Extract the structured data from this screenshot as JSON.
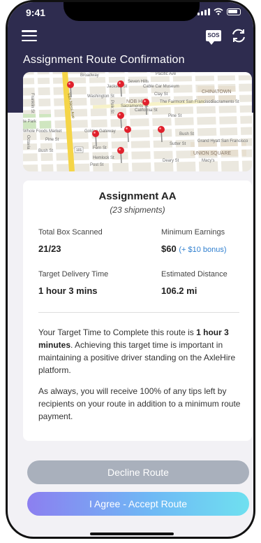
{
  "status_bar": {
    "time": "9:41"
  },
  "header": {
    "title": "Assignment Route Confirmation",
    "sos_label": "SOS"
  },
  "map": {
    "labels": {
      "broadway": "Broadway",
      "pacific": "Pacific Ave",
      "seven_hills": "Seven Hills",
      "jackson": "Jackson St",
      "cable_car": "Cable Car Museum",
      "franklin": "Franklin St",
      "washington": "Washington St",
      "chinatown": "CHINATOWN",
      "van_ness": "Van Ness Ave",
      "nob_hill": "NOB HILL",
      "clay": "Clay St",
      "fairmont": "The Fairmont San Francisco",
      "sacramento": "Sacramento St",
      "sacramento2": "Sacramento St",
      "polk": "Polk St",
      "california": "California St",
      "pine_east": "Pine St",
      "pine_west": "Pine St",
      "te_park": "te Park",
      "whole_foods": "Whole Foods Market",
      "golden_gateway": "Golden Gateway",
      "bush_east": "Bush St",
      "bush_west": "Bush St",
      "grand_hyatt": "Grand Hyatt San Francisco",
      "union_square": "UNION SQUARE",
      "fern": "Fern St",
      "sutter": "Sutter St",
      "hemlock": "Hemlock St",
      "post": "Post St",
      "deary": "Deary St",
      "macys": "Macy's",
      "hw_101": "101",
      "laguna": "Octavia"
    }
  },
  "assignment": {
    "title": "Assignment AA",
    "subtitle": "(23 shipments)",
    "box_label": "Total Box Scanned",
    "box_value": "21/23",
    "earnings_label": "Minimum Earnings",
    "earnings_value": "$60",
    "earnings_bonus": "(+ $10 bonus)",
    "time_label": "Target Delivery Time",
    "time_value": "1 hour 3 mins",
    "distance_label": "Estimated Distance",
    "distance_value": "106.2 mi",
    "para1_prefix": "Your Target Time to Complete this route is",
    "para1_bold": "1 hour 3 minutes",
    "para1_suffix": ". Achieving this target time is important in maintaining a positive driver standing on the AxleHire platform.",
    "para2": "As always, you will receive 100% of any tips left by recipients on your route in addition to a minimum route payment."
  },
  "actions": {
    "decline_label": "Decline Route",
    "accept_label": "I Agree - Accept Route"
  },
  "colors": {
    "header": "#2e2c4f",
    "decline": "#a9b0bc",
    "accept_start": "#8c7ff0",
    "accept_end": "#6fe0f0",
    "bonus": "#2f7fcf",
    "pin": "#e0202c"
  },
  "icons": [
    "hamburger-menu-icon",
    "sos-icon",
    "refresh-icon",
    "map-pin-icon"
  ]
}
